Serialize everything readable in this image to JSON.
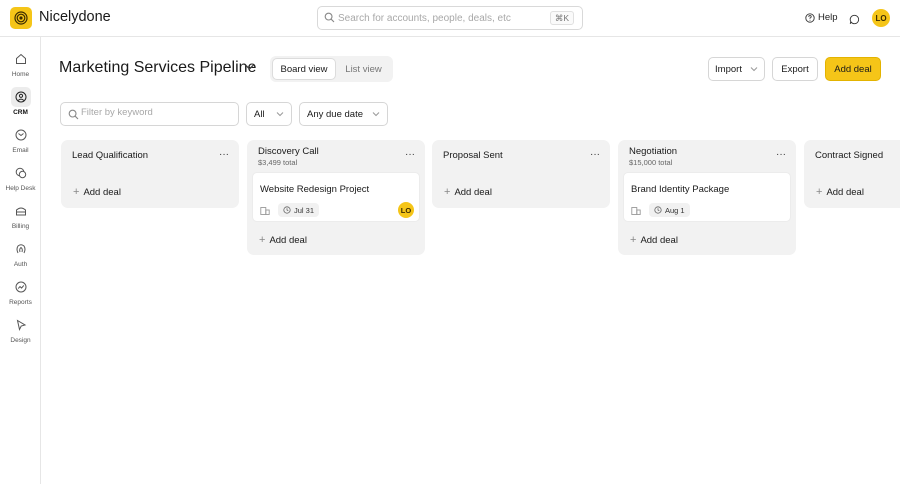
{
  "app": {
    "name": "Nicelydone"
  },
  "topbar": {
    "search_placeholder": "Search for accounts, people, deals, etc",
    "search_shortcut": "⌘K",
    "help_label": "Help",
    "user_initials": "LO"
  },
  "sidebar": {
    "items": [
      {
        "label": "Home",
        "icon": "home-icon"
      },
      {
        "label": "CRM",
        "icon": "crm-icon",
        "active": true
      },
      {
        "label": "Email",
        "icon": "email-icon"
      },
      {
        "label": "Help Desk",
        "icon": "help-desk-icon"
      },
      {
        "label": "Billing",
        "icon": "billing-icon"
      },
      {
        "label": "Auth",
        "icon": "auth-icon"
      },
      {
        "label": "Reports",
        "icon": "reports-icon"
      },
      {
        "label": "Design",
        "icon": "design-icon"
      }
    ]
  },
  "header": {
    "title": "Marketing Services Pipeline",
    "views": [
      "Board view",
      "List view"
    ],
    "active_view": "Board view",
    "import_label": "Import",
    "export_label": "Export",
    "add_deal_label": "Add deal"
  },
  "filters": {
    "keyword_placeholder": "Filter by keyword",
    "owner_value": "All",
    "due_value": "Any due date"
  },
  "board": {
    "add_deal_label": "Add deal",
    "more_label": "···",
    "columns": [
      {
        "title": "Lead Qualification",
        "total": "",
        "cards": []
      },
      {
        "title": "Discovery Call",
        "total": "$3,499 total",
        "cards": [
          {
            "title": "Website Redesign Project",
            "due": "Jul 31",
            "owner": "LO"
          }
        ]
      },
      {
        "title": "Proposal Sent",
        "total": "",
        "cards": []
      },
      {
        "title": "Negotiation",
        "total": "$15,000 total",
        "cards": [
          {
            "title": "Brand Identity Package",
            "due": "Aug 1",
            "owner": ""
          }
        ]
      },
      {
        "title": "Contract Signed",
        "total": "",
        "cards": []
      }
    ]
  },
  "colors": {
    "accent": "#f5c518",
    "column_bg": "#f2f2f2"
  }
}
